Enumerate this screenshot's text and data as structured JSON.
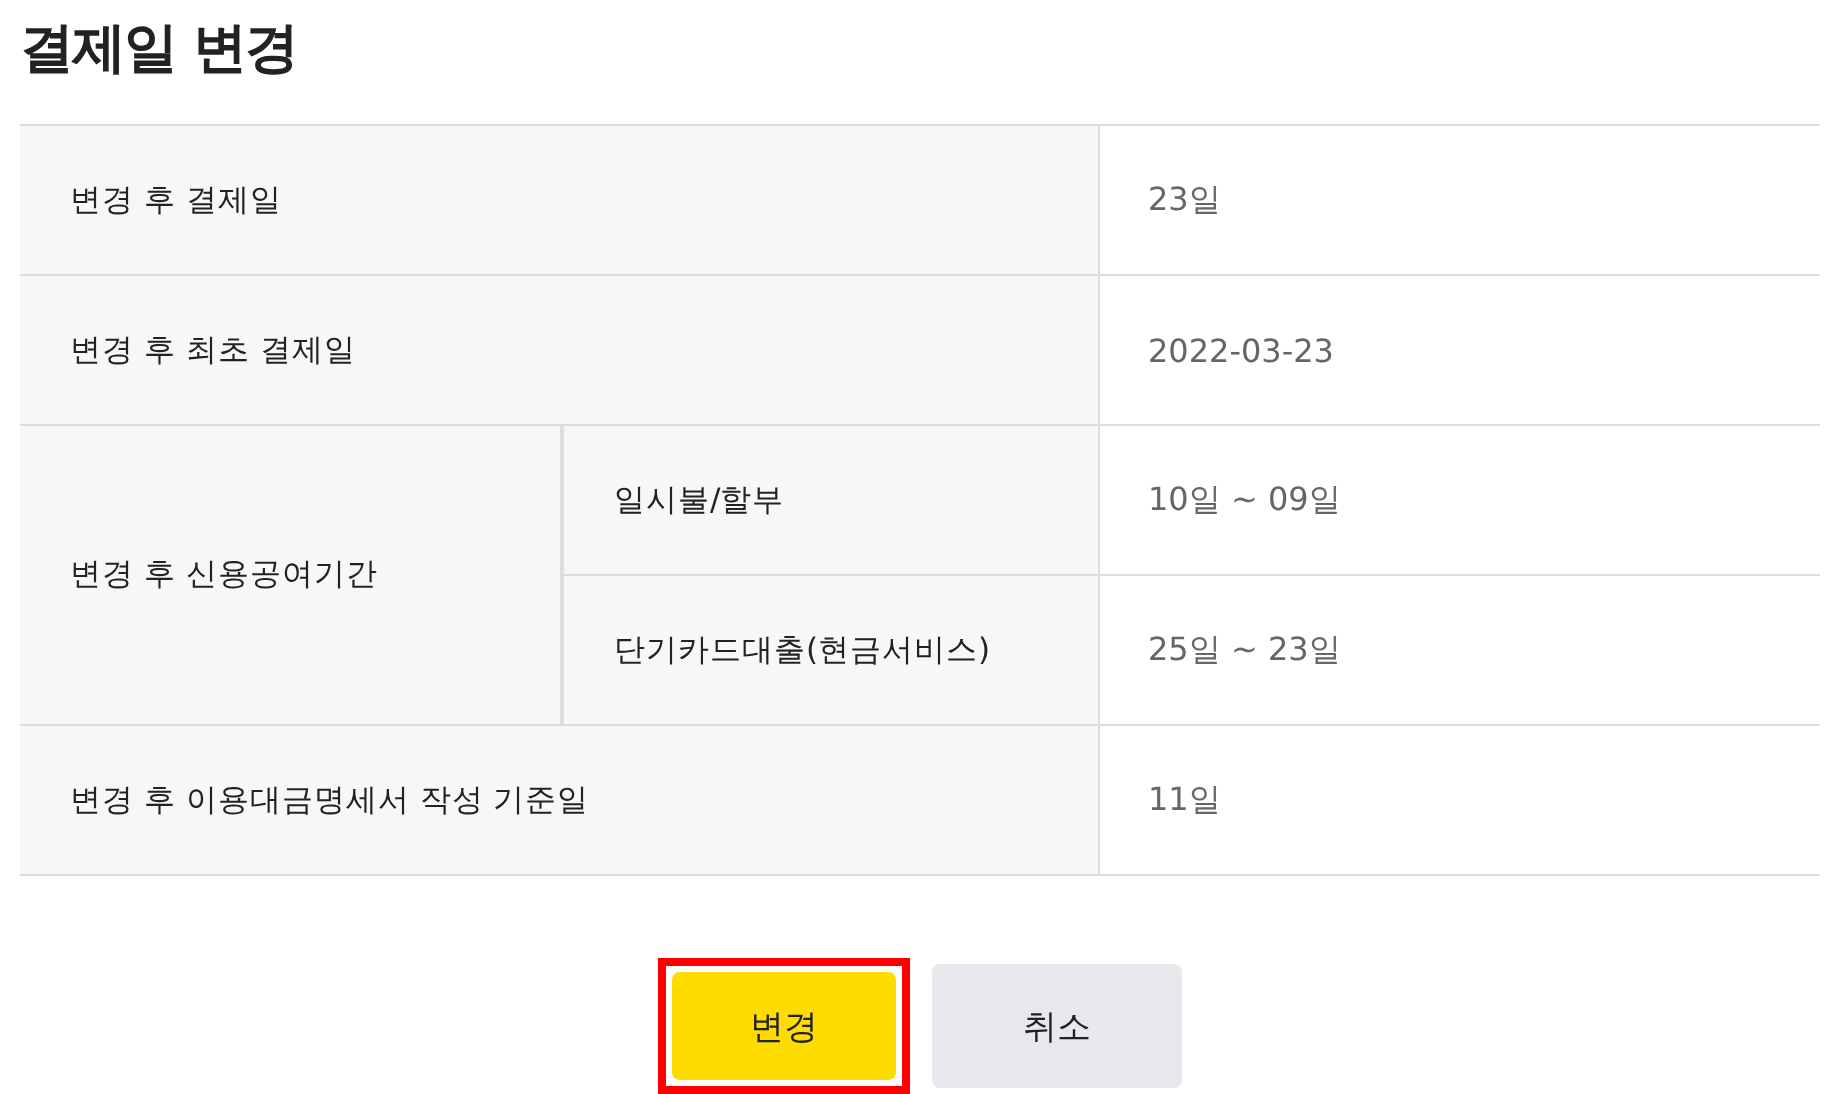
{
  "title": "결제일 변경",
  "rows": [
    {
      "label": "변경 후 결제일",
      "value": "23일"
    },
    {
      "label": "변경 후 최초 결제일",
      "value": "2022-03-23"
    },
    {
      "label": "변경 후 신용공여기간",
      "sub_rows": [
        {
          "label": "일시불/할부",
          "value": "10일 ~ 09일"
        },
        {
          "label": "단기카드대출(현금서비스)",
          "value": "25일 ~ 23일"
        }
      ]
    },
    {
      "label": "변경 후 이용대금명세서 작성 기준일",
      "value": "11일"
    }
  ],
  "buttons": [
    {
      "label": "변경",
      "kind": "primary",
      "highlighted": true
    },
    {
      "label": "취소",
      "kind": "secondary",
      "highlighted": false
    }
  ]
}
